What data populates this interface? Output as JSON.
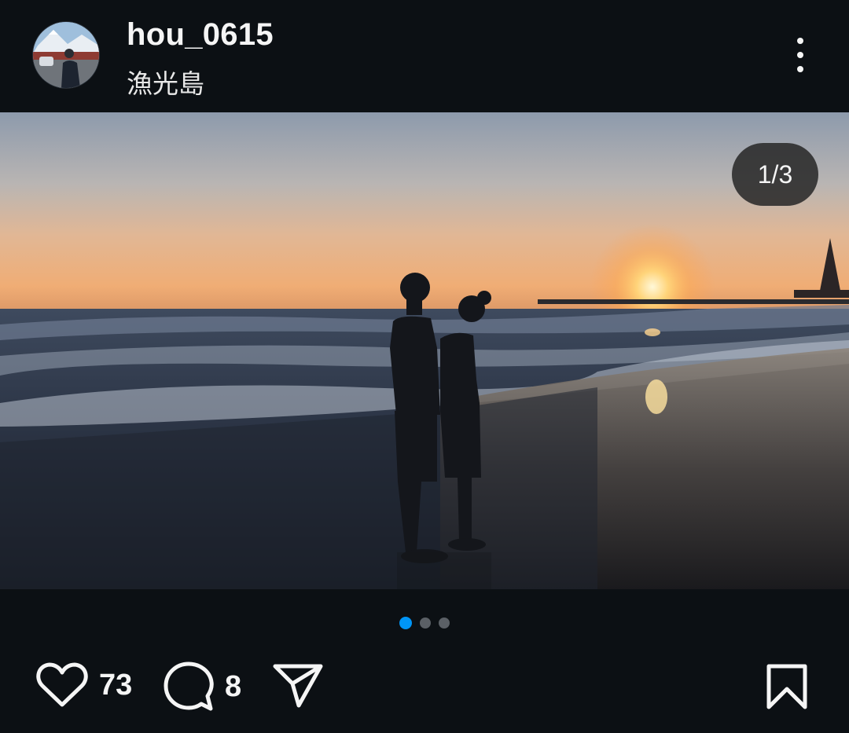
{
  "post": {
    "username": "hou_0615",
    "location": "漁光島",
    "image_counter": "1/3",
    "current_image": 1,
    "total_images": 3
  },
  "actions": {
    "likes": "73",
    "comments": "8"
  },
  "colors": {
    "background": "#0c1014",
    "text": "#f5f5f5",
    "active_dot": "#0095f6",
    "inactive_dot": "#5b6066"
  },
  "icons": [
    "more-icon",
    "heart-icon",
    "comment-icon",
    "share-icon",
    "bookmark-icon"
  ]
}
